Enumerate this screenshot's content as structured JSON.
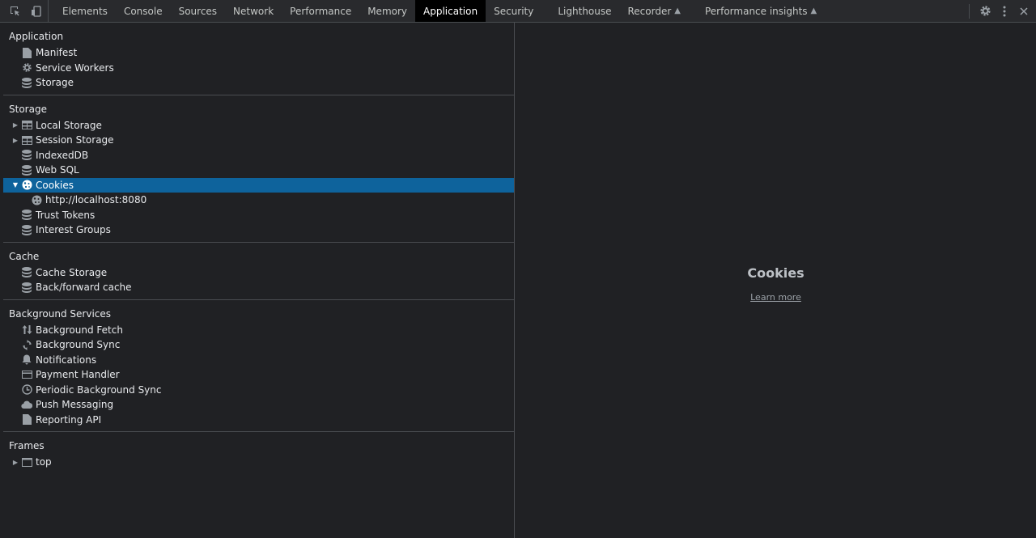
{
  "toolbar": {
    "tabs": [
      "Elements",
      "Console",
      "Sources",
      "Network",
      "Performance",
      "Memory",
      "Application",
      "Security",
      "Lighthouse",
      "Recorder",
      "Performance insights"
    ],
    "active_tab": "Application"
  },
  "sidebar": {
    "application": {
      "title": "Application",
      "items": [
        "Manifest",
        "Service Workers",
        "Storage"
      ]
    },
    "storage": {
      "title": "Storage",
      "items": [
        "Local Storage",
        "Session Storage",
        "IndexedDB",
        "Web SQL",
        "Cookies",
        "http://localhost:8080",
        "Trust Tokens",
        "Interest Groups"
      ]
    },
    "cache": {
      "title": "Cache",
      "items": [
        "Cache Storage",
        "Back/forward cache"
      ]
    },
    "background": {
      "title": "Background Services",
      "items": [
        "Background Fetch",
        "Background Sync",
        "Notifications",
        "Payment Handler",
        "Periodic Background Sync",
        "Push Messaging",
        "Reporting API"
      ]
    },
    "frames": {
      "title": "Frames",
      "items": [
        "top"
      ]
    }
  },
  "main": {
    "title": "Cookies",
    "link": "Learn more"
  },
  "colors": {
    "background": "#202124",
    "selected": "#0e639c",
    "toolbar": "#292a2d"
  }
}
